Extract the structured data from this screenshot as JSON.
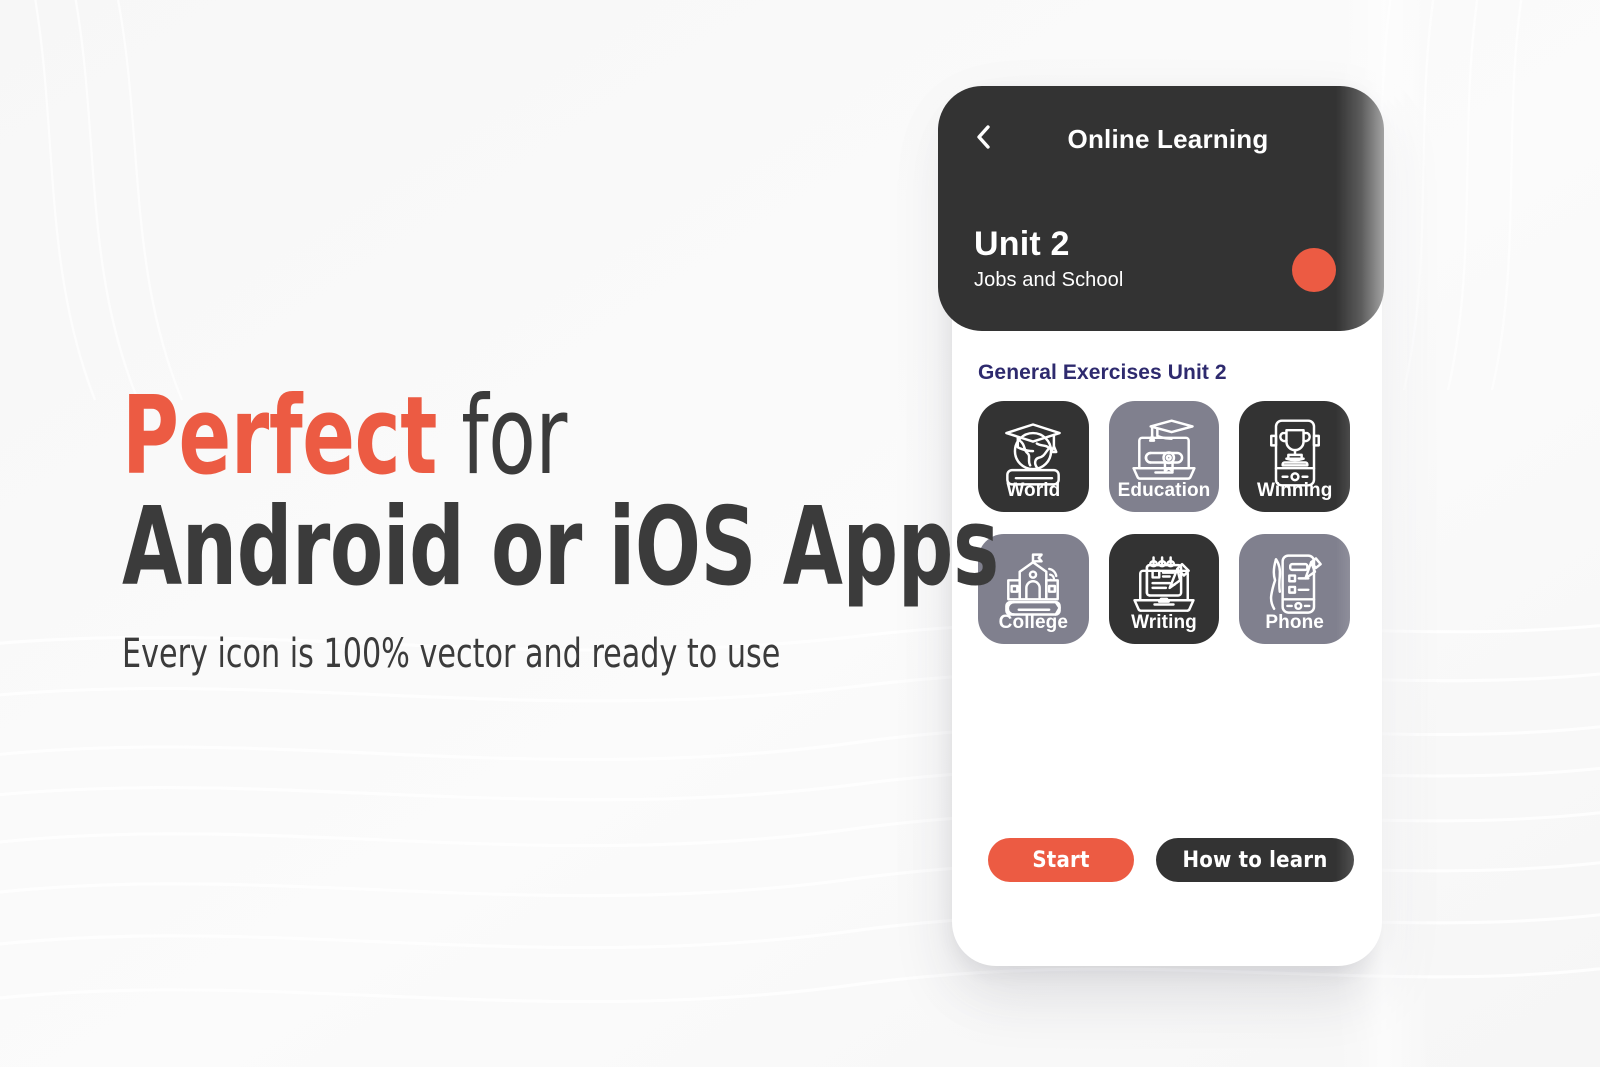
{
  "promo": {
    "headline_accent": "Perfect",
    "headline_rest": " for",
    "headline_line2": "Android or iOS Apps",
    "subline": "Every icon is 100% vector and ready to use",
    "accent_color": "#ec5b43",
    "text_color": "#3b3b3b"
  },
  "phone": {
    "header": {
      "back_icon": "chevron-left-icon",
      "title": "Online Learning",
      "unit_title": "Unit 2",
      "unit_subtitle": "Jobs and School",
      "dot_color": "#ec5b43",
      "background_color": "#333333"
    },
    "section_label": "General Exercises Unit 2",
    "section_label_color": "#2e2a6e",
    "tiles": [
      {
        "label": "World",
        "icon": "globe-graduation-book-icon",
        "theme": "dark",
        "bg": "#333333"
      },
      {
        "label": "Education",
        "icon": "laptop-diploma-cap-icon",
        "theme": "gray",
        "bg": "#80808e"
      },
      {
        "label": "Winning",
        "icon": "phone-trophy-icon",
        "theme": "dark",
        "bg": "#333333"
      },
      {
        "label": "College",
        "icon": "school-building-wifi-icon",
        "theme": "gray",
        "bg": "#80808e"
      },
      {
        "label": "Writing",
        "icon": "laptop-notepad-pencil-icon",
        "theme": "dark",
        "bg": "#333333"
      },
      {
        "label": "Phone",
        "icon": "hand-phone-checklist-icon",
        "theme": "gray",
        "bg": "#80808e"
      }
    ],
    "buttons": {
      "primary": "Start",
      "secondary": "How to learn",
      "primary_color": "#ec5b43",
      "secondary_color": "#333333"
    }
  }
}
